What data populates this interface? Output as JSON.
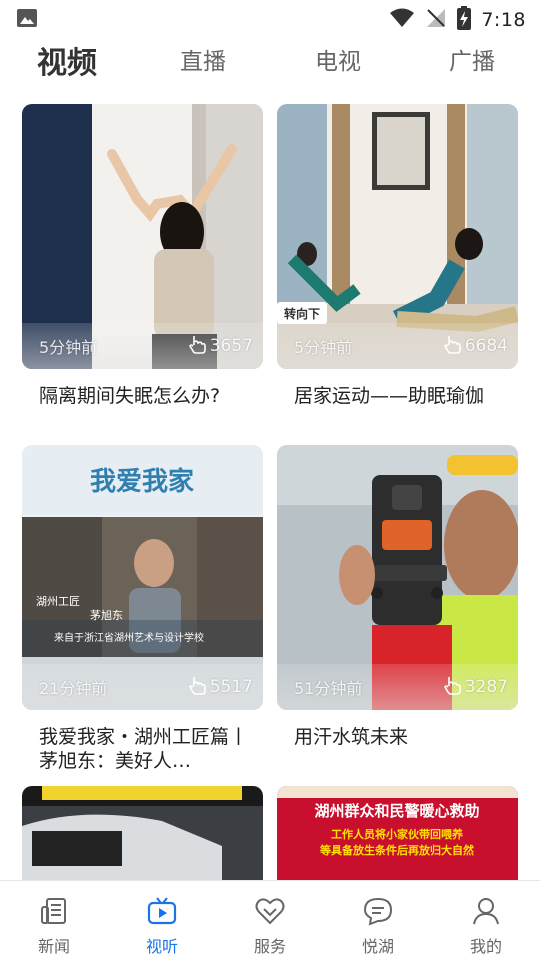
{
  "status_bar": {
    "time": "7:18"
  },
  "top_tabs": [
    {
      "label": "视频",
      "active": true
    },
    {
      "label": "直播",
      "active": false
    },
    {
      "label": "电视",
      "active": false
    },
    {
      "label": "广播",
      "active": false
    }
  ],
  "cards": [
    {
      "time": "5分钟前",
      "views": "3657",
      "title": "隔离期间失眠怎么办?"
    },
    {
      "time": "5分钟前",
      "views": "6684",
      "title": "居家运动——助眠瑜伽",
      "thumb_caption": "转向下"
    },
    {
      "time": "21分钟前",
      "views": "5517",
      "title": "我爱我家・湖州工匠篇丨茅旭东：美好人…",
      "thumb_heading": "我爱我家",
      "thumb_caption1": "湖州工匠",
      "thumb_caption2": "茅旭东",
      "thumb_caption3": "来自于浙江省湖州艺术与设计学校"
    },
    {
      "time": "51分钟前",
      "views": "3287",
      "title": "用汗水筑未来"
    }
  ],
  "partial_cards": [
    {
      "top_text": ""
    },
    {
      "banner_title": "湖州群众和民警暖心救助",
      "banner_line1": "工作人员将小家伙带回喂养",
      "banner_line2": "等具备放生条件后再放归大自然"
    }
  ],
  "bottom_nav": [
    {
      "label": "新闻",
      "icon": "news-icon",
      "active": false
    },
    {
      "label": "视听",
      "icon": "tv-icon",
      "active": true
    },
    {
      "label": "服务",
      "icon": "heart-icon",
      "active": false
    },
    {
      "label": "悦湖",
      "icon": "chat-icon",
      "active": false
    },
    {
      "label": "我的",
      "icon": "profile-icon",
      "active": false
    }
  ],
  "colors": {
    "accent": "#1a73e8",
    "tab_inactive": "#666666",
    "text": "#222222"
  }
}
